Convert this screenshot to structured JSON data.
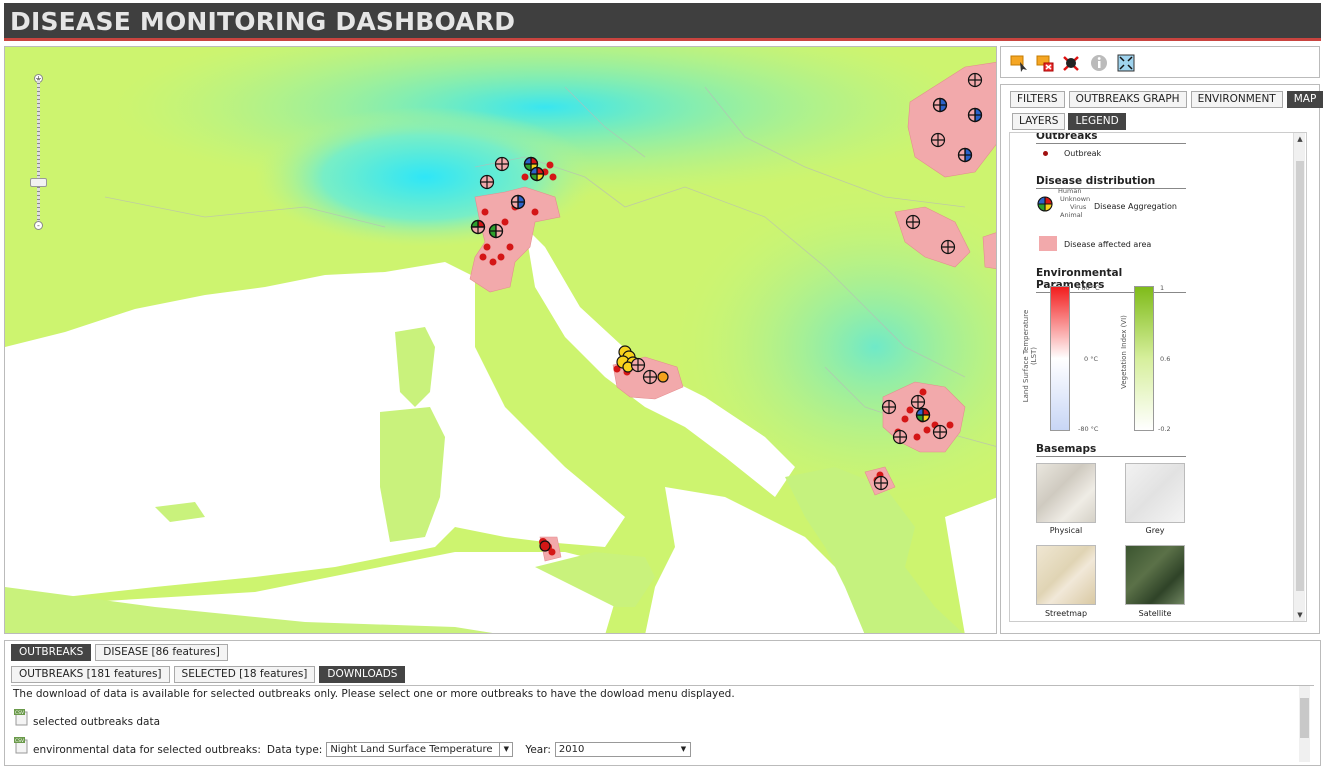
{
  "header": {
    "title": "DISEASE MONITORING DASHBOARD"
  },
  "toolbar": {
    "icons": [
      "select-icon",
      "deselect-icon",
      "clear-selection-icon",
      "info-icon",
      "zoom-extent-icon"
    ]
  },
  "tabs": {
    "filters": "FILTERS",
    "outbreaks_graph": "OUTBREAKS GRAPH",
    "environment": "ENVIRONMENT",
    "map": "MAP"
  },
  "subtabs": {
    "layers": "LAYERS",
    "legend": "LEGEND"
  },
  "legend": {
    "outbreaks_title": "Outbreaks",
    "outbreak_label": "Outbreak",
    "distribution_title": "Disease distribution",
    "agg_human": "Human",
    "agg_unknown": "Unknown",
    "agg_virus": "Virus",
    "agg_animal": "Animal",
    "agg_label": "Disease Aggregation",
    "affected_label": "Disease affected area",
    "env_title": "Environmental Parameters",
    "lst_label": "Land Surface Temperature (LST)",
    "lst_max": "+80 °C",
    "lst_mid": "0 °C",
    "lst_min": "-80 °C",
    "vi_label": "Vegetation Index (VI)",
    "vi_max": "1",
    "vi_mid": "0.6",
    "vi_min": "-0.2",
    "basemaps_title": "Basemaps",
    "basemaps": [
      "Physical",
      "Grey",
      "Streetmap",
      "Satellite"
    ]
  },
  "colors": {
    "header_bg": "#3f3f3f",
    "header_accent": "#c9443f",
    "affected_area": "#f2a9ab",
    "outbreak": "#d41616",
    "sea": "#ffffff",
    "land_low": "#d8f56a",
    "land_high": "#2ee8f5"
  },
  "bottom": {
    "tab_outbreaks": "OUTBREAKS",
    "tab_disease": "DISEASE [86 features]",
    "sub_outbreaks": "OUTBREAKS [181 features]",
    "sub_selected": "SELECTED [18 features]",
    "sub_downloads": "DOWNLOADS",
    "info": "The download of data is available for selected outbreaks only. Please select one or more outbreaks to have the dowload menu displayed.",
    "dl_outbreaks": "selected outbreaks data",
    "dl_env": "environmental data for selected outbreaks:",
    "data_type_label": "Data type:",
    "data_type_value": "Night Land Surface Temperature",
    "year_label": "Year:",
    "year_value": "2010"
  }
}
